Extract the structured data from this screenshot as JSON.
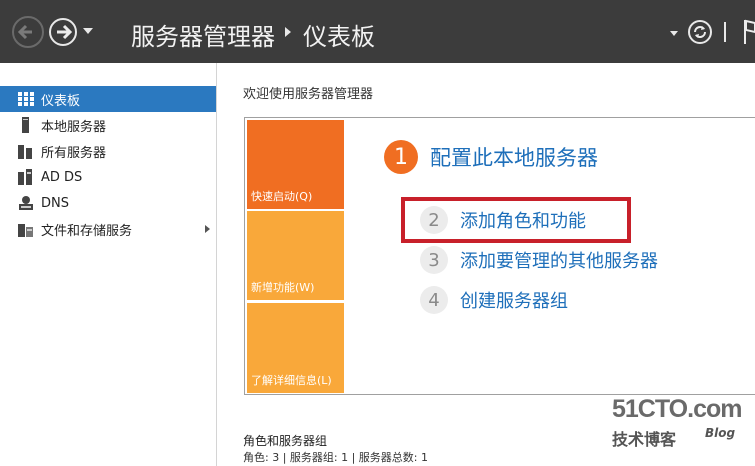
{
  "header": {
    "app_title": "服务器管理器",
    "page_title": "仪表板"
  },
  "sidebar": {
    "items": [
      {
        "label": "仪表板",
        "icon": "dashboard-icon",
        "active": true
      },
      {
        "label": "本地服务器",
        "icon": "server-icon",
        "active": false
      },
      {
        "label": "所有服务器",
        "icon": "servers-icon",
        "active": false
      },
      {
        "label": "AD DS",
        "icon": "ad-ds-icon",
        "active": false
      },
      {
        "label": "DNS",
        "icon": "dns-icon",
        "active": false
      },
      {
        "label": "文件和存储服务",
        "icon": "file-storage-icon",
        "active": false,
        "has_submenu": true
      }
    ]
  },
  "main": {
    "welcome_title": "欢迎使用服务器管理器",
    "tiles": {
      "quick_start": "快速启动(Q)",
      "whats_new": "新增功能(W)",
      "learn_more": "了解详细信息(L)"
    },
    "steps": [
      {
        "num": "1",
        "label": "配置此本地服务器"
      },
      {
        "num": "2",
        "label": "添加角色和功能"
      },
      {
        "num": "3",
        "label": "添加要管理的其他服务器"
      },
      {
        "num": "4",
        "label": "创建服务器组"
      }
    ],
    "roles_title": "角色和服务器组",
    "roles_summary": "角色: 3 | 服务器组: 1 | 服务器总数: 1"
  },
  "watermark": {
    "main": "51CTO.com",
    "sub": "技术博客",
    "blog": "Blog"
  },
  "colors": {
    "titlebar": "#3c3c3c",
    "accent_blue": "#2b79c0",
    "link_blue": "#1e6fba",
    "tile_orange": "#f06e22",
    "tile_amber": "#f9a83a",
    "highlight_red": "#c8202a"
  }
}
